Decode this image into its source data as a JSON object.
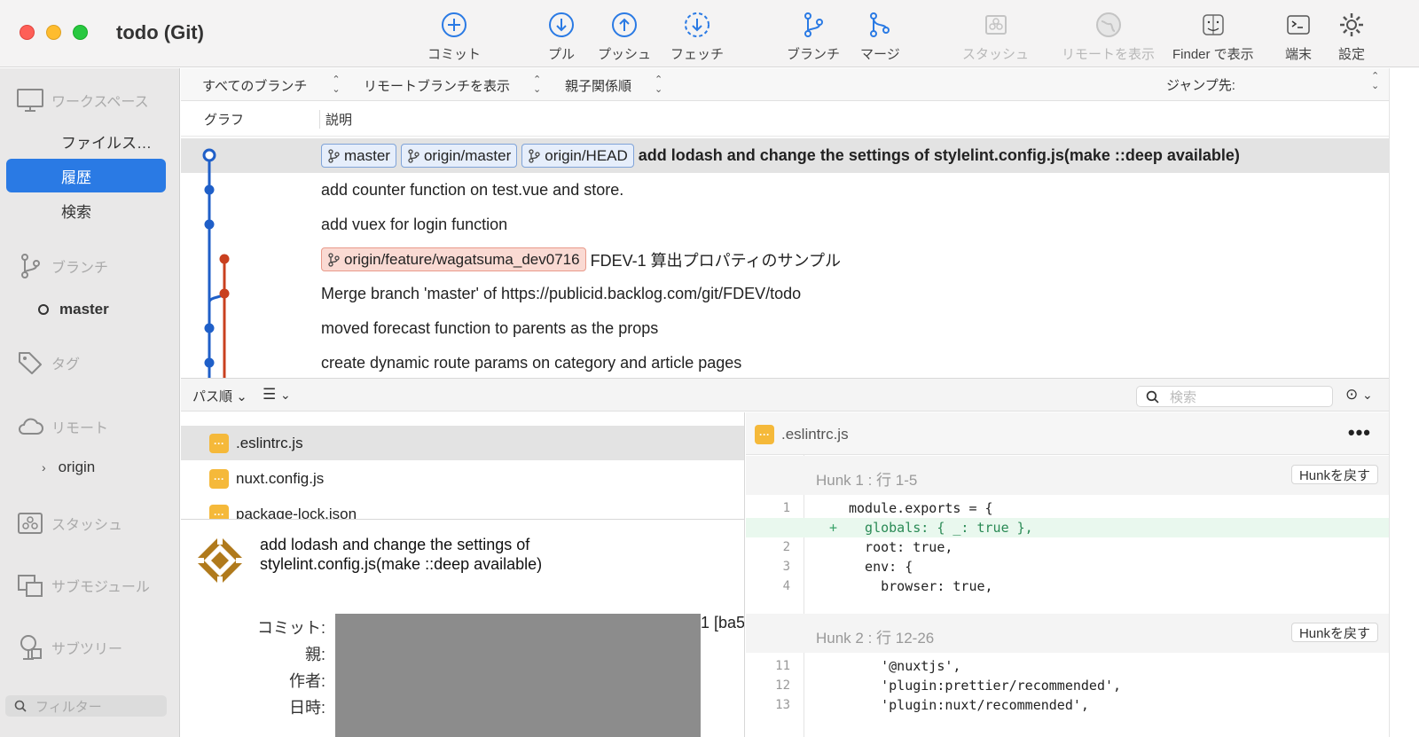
{
  "window": {
    "title": "todo (Git)"
  },
  "toolbar": {
    "commit": "コミット",
    "pull": "プル",
    "push": "プッシュ",
    "fetch": "フェッチ",
    "branch": "ブランチ",
    "merge": "マージ",
    "stash": "スタッシュ",
    "show_remote": "リモートを表示",
    "show_in_finder": "Finder で表示",
    "terminal": "端末",
    "settings": "設定"
  },
  "sidebar": {
    "workspace": "ワークスペース",
    "workspace_items": [
      "ファイルス…",
      "履歴",
      "検索"
    ],
    "branches": "ブランチ",
    "current_branch": "master",
    "tags": "タグ",
    "remotes": "リモート",
    "remote_origin": "origin",
    "stashes": "スタッシュ",
    "submodules": "サブモジュール",
    "subtrees": "サブツリー",
    "filter_placeholder": "フィルター"
  },
  "filterbar": {
    "branches": "すべてのブランチ",
    "remote_branches": "リモートブランチを表示",
    "order": "親子関係順",
    "jump_to": "ジャンプ先:"
  },
  "columns": {
    "graph": "グラフ",
    "description": "説明"
  },
  "history": [
    {
      "refs": [
        "master",
        "origin/master",
        "origin/HEAD"
      ],
      "message": "add lodash and change the settings of stylelint.config.js(make ::deep available)",
      "selected": true
    },
    {
      "refs": [],
      "message": "add counter function on test.vue and store."
    },
    {
      "refs": [],
      "message": "add vuex for login function"
    },
    {
      "refs": [
        "origin/feature/wagatsuma_dev0716"
      ],
      "message": "FDEV-1 算出プロパティのサンプル"
    },
    {
      "refs": [],
      "message": "Merge branch 'master' of https://publicid.backlog.com/git/FDEV/todo"
    },
    {
      "refs": [],
      "message": "moved forecast function to parents as the props"
    },
    {
      "refs": [],
      "message": "create dynamic route params on category and article pages"
    }
  ],
  "lowerbar": {
    "sort": "パス順",
    "search_placeholder": "検索"
  },
  "files": [
    ".eslintrc.js",
    "nuxt.config.js",
    "package-lock.json"
  ],
  "commit_info": {
    "subject": "add lodash and change the settings of stylelint.config.js(make ::deep available)",
    "labels": [
      "コミット:",
      "親:",
      "作者:",
      "日時:"
    ],
    "partial_hash": "1 [ba5"
  },
  "diff": {
    "file": ".eslintrc.js",
    "revert_label": "Hunkを戻す",
    "hunks": [
      {
        "title": "Hunk 1 : 行 1-5",
        "lines": [
          {
            "n": "1",
            "sign": "",
            "text": "module.exports = {",
            "added": false
          },
          {
            "n": "",
            "sign": "+",
            "text": "  globals: { _: true },",
            "added": true
          },
          {
            "n": "2",
            "sign": "",
            "text": "  root: true,",
            "added": false
          },
          {
            "n": "3",
            "sign": "",
            "text": "  env: {",
            "added": false
          },
          {
            "n": "4",
            "sign": "",
            "text": "    browser: true,",
            "added": false
          }
        ]
      },
      {
        "title": "Hunk 2 : 行 12-26",
        "lines": [
          {
            "n": "11",
            "sign": "",
            "text": "    '@nuxtjs',",
            "added": false
          },
          {
            "n": "12",
            "sign": "",
            "text": "    'plugin:prettier/recommended',",
            "added": false
          },
          {
            "n": "13",
            "sign": "",
            "text": "    'plugin:nuxt/recommended',",
            "added": false
          }
        ]
      }
    ]
  },
  "colors": {
    "accent": "#2a7ae4",
    "graph_blue": "#1f5fc8",
    "graph_red": "#c9401f",
    "selected_row": "#e3e3e3",
    "added_line": "#e9f8ee"
  }
}
